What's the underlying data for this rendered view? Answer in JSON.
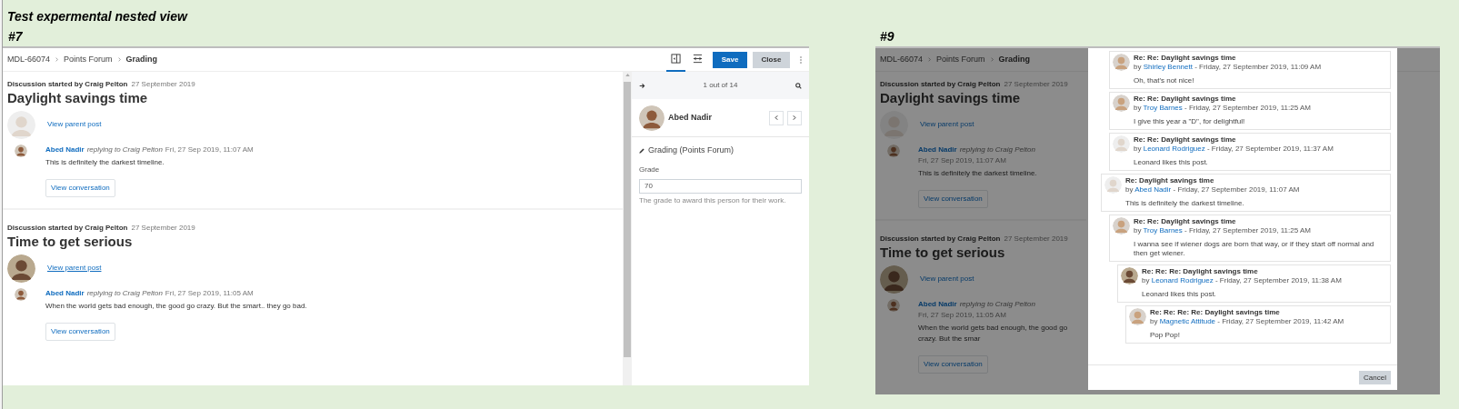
{
  "sheet": {
    "title": "Test expermental nested view",
    "labels": [
      "#7",
      "#9"
    ]
  },
  "grader": {
    "breadcrumb": [
      "MDL-66074",
      "Points Forum",
      "Grading"
    ],
    "view_toggles": [
      {
        "kind": "panel",
        "selected": true
      },
      {
        "kind": "collapse",
        "selected": false
      }
    ],
    "save": "Save",
    "close": "Close",
    "discussions": [
      {
        "started_by": "Discussion started by Craig Pelton",
        "date": "27 September 2019",
        "title": "Daylight savings time",
        "parent_link": "View parent post",
        "hovered": false,
        "author": "Abed Nadir",
        "replying": "replying to Craig Pelton",
        "time": "Fri, 27 Sep 2019, 11:07 AM",
        "message": "This is definitely the darkest timeline.",
        "button": "View conversation"
      },
      {
        "started_by": "Discussion started by Craig Pelton",
        "date": "27 September 2019",
        "title": "Time to get serious",
        "parent_link": "View parent post",
        "hovered": true,
        "author": "Abed Nadir",
        "replying": "replying to Craig Pelton",
        "time": "Fri, 27 Sep 2019, 11:05 AM",
        "message": "When the world gets bad enough, the good go crazy. But the smart.. they go bad.",
        "button": "View conversation"
      }
    ],
    "panel": {
      "counter": "1 out of 14",
      "user": "Abed Nadir",
      "section": "Grading (Points Forum)",
      "grade_label": "Grade",
      "grade_value": "70",
      "help": "The grade to award this person for their work."
    }
  },
  "nested_view": {
    "breadcrumb": [
      "MDL-66074",
      "Points Forum",
      "Grading"
    ],
    "discussions": [
      {
        "started_by": "Discussion started by Craig Pelton",
        "date": "27 September 2019",
        "title": "Daylight savings time",
        "parent_link": "View parent post",
        "author": "Abed Nadir",
        "replying": "replying to Craig Pelton",
        "time": "Fri, 27 Sep 2019, 11:07 AM",
        "message": "This is definitely the darkest timeline.",
        "button": "View conversation"
      },
      {
        "started_by": "Discussion started by Craig Pelton",
        "date": "27 September 2019",
        "title": "Time to get serious",
        "parent_link": "View parent post",
        "author": "Abed Nadir",
        "replying": "replying to Craig Pelton",
        "time": "Fri, 27 Sep 2019, 11:05 AM",
        "message": "When the world gets bad enough, the good go crazy. But the smar",
        "button": "View conversation"
      }
    ],
    "modal": {
      "earlier_replies": [
        {
          "title": "Re: Re: Daylight savings time",
          "by": "by",
          "author": "Shirley Bennett",
          "when": " - Friday, 27 September 2019, 11:09 AM",
          "message": "Oh, that's not nice!"
        },
        {
          "title": "Re: Re: Daylight savings time",
          "by": "by",
          "author": "Troy Barnes",
          "when": " - Friday, 27 September 2019, 11:25 AM",
          "message": "I give this year a \"D\", for delightful!"
        },
        {
          "title": "Re: Re: Daylight savings time",
          "by": "by",
          "author": "Leonard Rodriguez",
          "when": " - Friday, 27 September 2019, 11:37 AM",
          "message": "Leonard likes this post."
        }
      ],
      "posts": [
        {
          "title": "Re: Daylight savings time",
          "by": "by",
          "author": "Abed Nadir",
          "when": " - Friday, 27 September 2019, 11:07 AM",
          "message": "This is definitely the darkest timeline.",
          "children": [
            {
              "title": "Re: Re: Daylight savings time",
              "by": "by",
              "author": "Troy Barnes",
              "when": " - Friday, 27 September 2019, 11:25 AM",
              "message": "I wanna see if wiener dogs are born that way, or if they start off normal and then get wiener.",
              "children": [
                {
                  "title": "Re: Re: Re: Daylight savings time",
                  "by": "by",
                  "author": "Leonard Rodriguez",
                  "when": " - Friday, 27 September 2019, 11:38 AM",
                  "message": "Leonard likes this post.",
                  "children": [
                    {
                      "title": "Re: Re: Re: Re: Daylight savings time",
                      "by": "by",
                      "author": "Magnetic Attitude",
                      "when": " - Friday, 27 September 2019, 11:42 AM",
                      "message": "Pop Pop!"
                    }
                  ]
                }
              ]
            }
          ]
        }
      ],
      "cancel": "Cancel"
    }
  }
}
